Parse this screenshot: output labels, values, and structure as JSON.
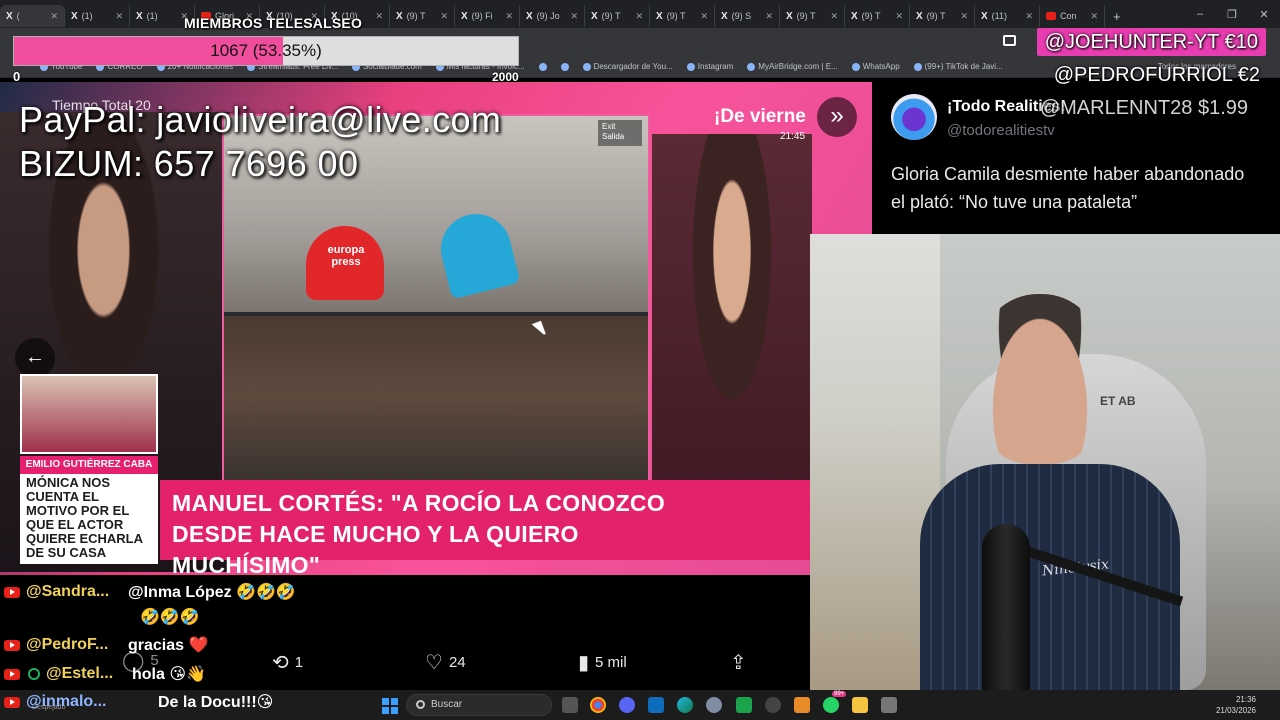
{
  "browser": {
    "tabs": [
      {
        "icon": "X",
        "label": "(",
        "active": true
      },
      {
        "icon": "X",
        "label": "(1)"
      },
      {
        "icon": "X",
        "label": "(1)"
      },
      {
        "icon": "yt",
        "label": "Glori"
      },
      {
        "icon": "X",
        "label": "(10)"
      },
      {
        "icon": "X",
        "label": "(10)"
      },
      {
        "icon": "X",
        "label": "(9) T"
      },
      {
        "icon": "X",
        "label": "(9) Fi"
      },
      {
        "icon": "X",
        "label": "(9) Jo"
      },
      {
        "icon": "X",
        "label": "(9) T"
      },
      {
        "icon": "X",
        "label": "(9) T"
      },
      {
        "icon": "X",
        "label": "(9) S"
      },
      {
        "icon": "X",
        "label": "(9) T"
      },
      {
        "icon": "X",
        "label": "(9) T"
      },
      {
        "icon": "X",
        "label": "(9) T"
      },
      {
        "icon": "X",
        "label": "(11)"
      },
      {
        "icon": "yt",
        "label": "Con"
      }
    ],
    "new_tab": "+",
    "window_controls": [
      "–",
      "❐",
      "✕"
    ],
    "bookmarks": [
      "YouTube",
      "CORREO",
      "20+ Notificaciones",
      "Streamlabs: Free Liv...",
      "Socialblade.com",
      "Mis facturas - Invoic...",
      "",
      "",
      "Descargador de You...",
      "Instagram",
      "MyAirBridge.com | E...",
      "WhatsApp",
      "(99+) TikTok de Javi..."
    ],
    "bookmarks_all": "Todos los marcadores",
    "menu": "⋮"
  },
  "overlay": {
    "members_title": "MIEMBROS TELESALSEO",
    "goal_text": "1067 (53.35%)",
    "goal_progress": 0.5335,
    "goal_min": "0",
    "goal_max": "2000",
    "donations": [
      "@JOEHUNTER-YT  €10",
      "@PEDROFURRIOL  €2",
      "@MARLENNT28  $1.99"
    ],
    "paypal": "PayPal: javioliveira@live.com",
    "bizum": "BIZUM: 657 7696 00"
  },
  "tv": {
    "top_left": "Tiempo Total 20",
    "right_ticker": "¡De vierne",
    "clock": "21:45",
    "mic_label": "europa press",
    "exit_sign": "Exit Salida",
    "thumb_name": "EMILIO GUTIÉRREZ CABA",
    "thumb_text": "MÓNICA NOS CUENTA EL MOTIVO POR EL QUE EL ACTOR QUIERE ECHARLA DE SU CASA",
    "headline": "MANUEL CORTÉS: \"A ROCÍO LA CONOZCO DESDE HACE MUCHO Y LA QUIERO MUCHÍSIMO\"",
    "next_icon": "»",
    "prev_icon": "←"
  },
  "tweet": {
    "name": "¡Todo Realities!",
    "handle": "@todorealitiestv",
    "text": "Gloria Camila desmiente haber abandonado el plató: “No tuve una pataleta”",
    "replies": "5",
    "retweets": "1",
    "likes": "24",
    "views": "5 mil"
  },
  "chat": [
    {
      "user": "@Sandra...",
      "msg": "@Inma López 🤣🤣🤣"
    },
    {
      "user": "",
      "msg": "🤣🤣🤣"
    },
    {
      "user": "@PedroF...",
      "msg": "gracias ❤️"
    },
    {
      "user": "@Estel...",
      "msg": "hola 😘👋"
    },
    {
      "user": "@inmalo...",
      "msg": "De la Docu!!!😘"
    }
  ],
  "webcam": {
    "shirt_text": "Ninetysix",
    "chair_logo": "ET AB"
  },
  "taskbar": {
    "left_text": "Despejado",
    "search_placeholder": "Buscar",
    "time": "21:36",
    "date": "21/03/2026",
    "badge": "99+"
  }
}
